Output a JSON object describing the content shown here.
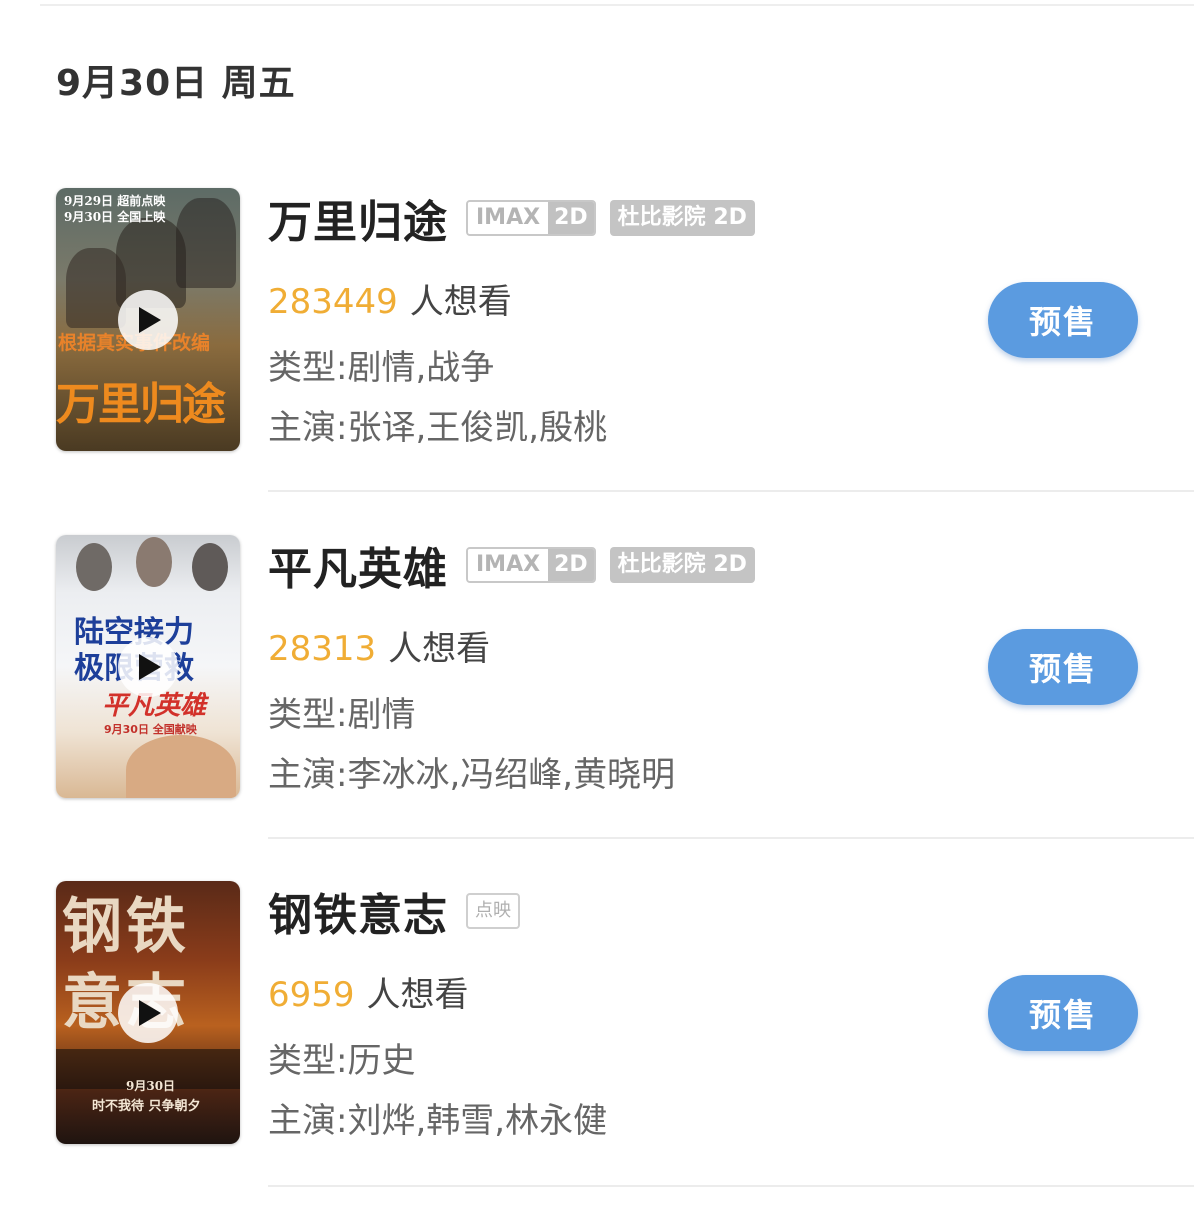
{
  "date_header": "9月30日 周五",
  "movies": [
    {
      "title": "万里归途",
      "tags": {
        "imax": "IMAX",
        "imax_format": "2D",
        "dolby": "杜比影院 2D"
      },
      "want_count": "283449",
      "want_suffix": "人想看",
      "genre": "类型:剧情,战争",
      "cast": "主演:张译,王俊凯,殷桃",
      "button": "预售",
      "poster": {
        "line1": "9月29日 超前点映",
        "line2": "9月30日 全国上映",
        "tagline": "根据真实事件改编",
        "big_title": "万里归途"
      }
    },
    {
      "title": "平凡英雄",
      "tags": {
        "imax": "IMAX",
        "imax_format": "2D",
        "dolby": "杜比影院 2D"
      },
      "want_count": "28313",
      "want_suffix": "人想看",
      "genre": "类型:剧情",
      "cast": "主演:李冰冰,冯绍峰,黄晓明",
      "button": "预售",
      "poster": {
        "tagline1": "陆空接力",
        "tagline2": "极限营救",
        "script_title": "平凡英雄",
        "date": "9月30日 全国献映"
      }
    },
    {
      "title": "钢铁意志",
      "tags": {
        "preview": "点映"
      },
      "want_count": "6959",
      "want_suffix": "人想看",
      "genre": "类型:历史",
      "cast": "主演:刘烨,韩雪,林永健",
      "button": "预售",
      "poster": {
        "big_title": "钢铁意志",
        "date": "9月30日",
        "slogan": "时不我待 只争朝夕"
      }
    }
  ]
}
